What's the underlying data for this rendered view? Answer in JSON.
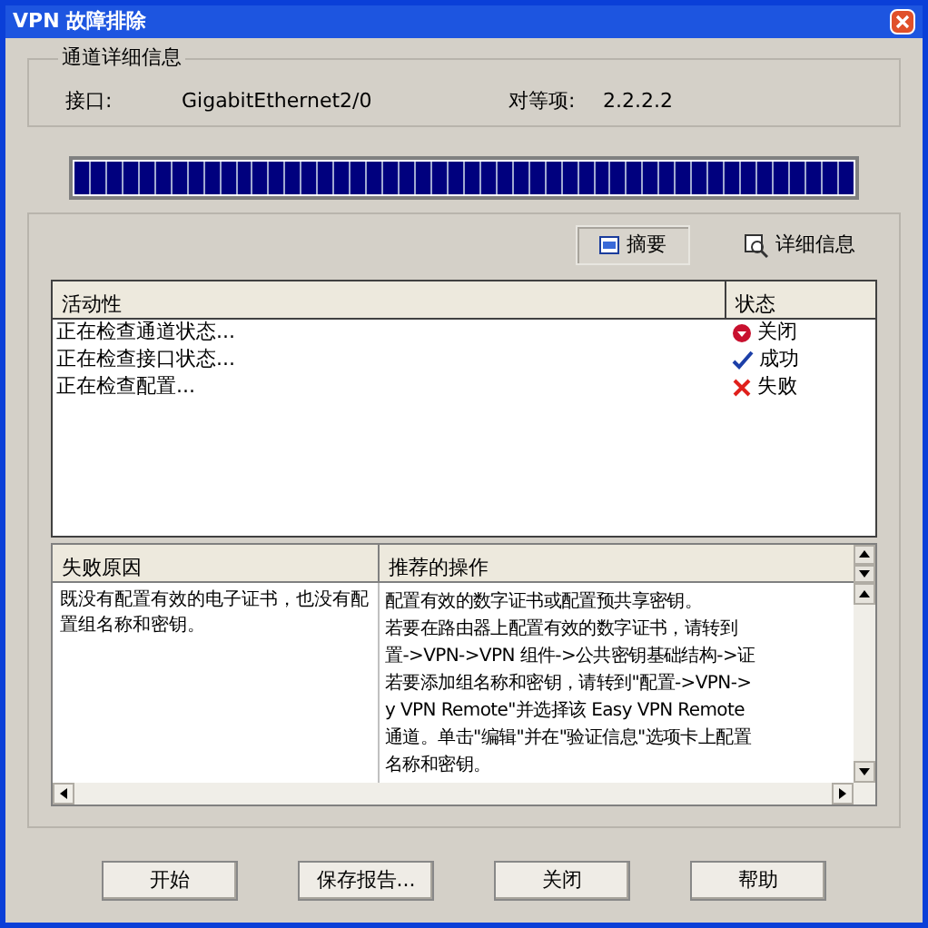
{
  "window": {
    "title": "VPN 故障排除"
  },
  "tunnel_details": {
    "title": "通道详细信息",
    "interface_label": "接口:",
    "interface_value": "GigabitEthernet2/0",
    "peer_label": "对等项:",
    "peer_value": "2.2.2.2"
  },
  "progress": {
    "level": 1
  },
  "view_tabs": [
    {
      "label": "摘要",
      "selected": true
    },
    {
      "label": "详细信息",
      "selected": false
    }
  ],
  "activity_table": {
    "columns": [
      "活动性",
      "状态"
    ],
    "rows": [
      {
        "activity": "正在检查通道状态...",
        "status": "关闭",
        "kind": "down"
      },
      {
        "activity": "正在检查接口状态...",
        "status": "成功",
        "kind": "success"
      },
      {
        "activity": "正在检查配置...",
        "status": "失败",
        "kind": "failed"
      }
    ]
  },
  "details": {
    "columns": [
      "失败原因",
      "推荐的操作"
    ],
    "reason": "既没有配置有效的电子证书，也没有配置组名称和密钥。",
    "actions": [
      "配置有效的数字证书或配置预共享密钥。",
      "若要在路由器上配置有效的数字证书，请转到",
      "置->VPN->VPN 组件->公共密钥基础结构->证",
      "若要添加组名称和密钥，请转到\"配置->VPN->",
      "y VPN Remote\"并选择该 Easy VPN Remote",
      "通道。单击\"编辑\"并在\"验证信息\"选项卡上配置",
      "名称和密钥。"
    ]
  },
  "buttons": [
    "开始",
    "保存报告...",
    "关闭",
    "帮助"
  ]
}
